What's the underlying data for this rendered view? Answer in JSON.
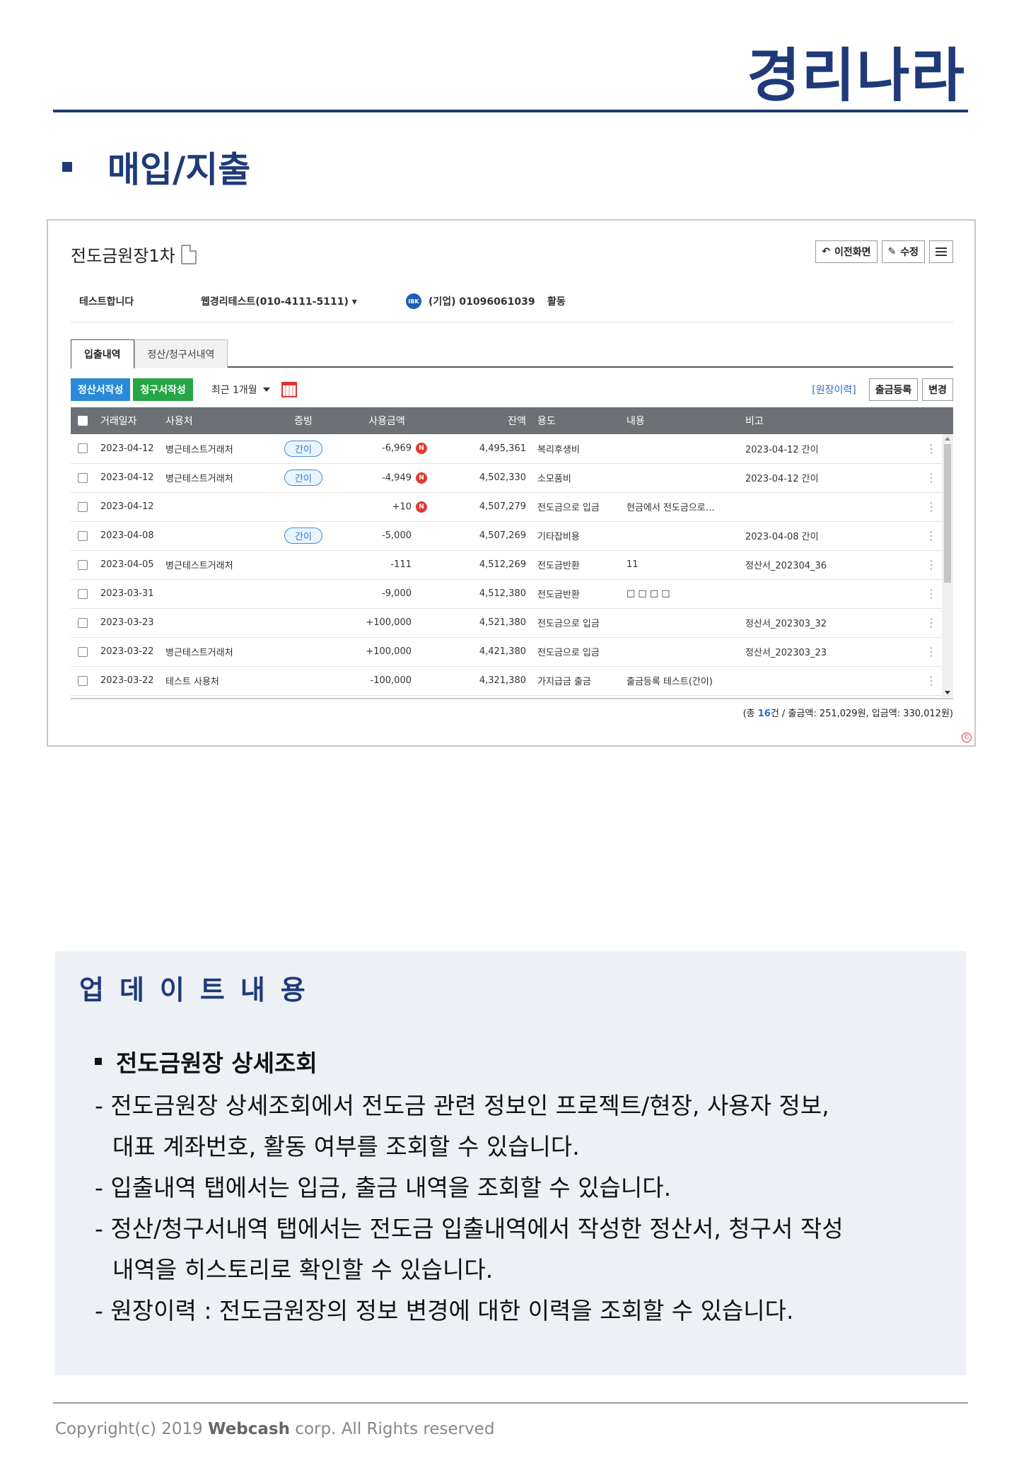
{
  "header": {
    "logo_text": "경리나라",
    "section_title": "매입/지출"
  },
  "screen": {
    "doc_title": "전도금원장1차",
    "buttons": {
      "back": "이전화면",
      "edit": "수정"
    },
    "info": {
      "project": "테스트합니다",
      "user": "웹경리테스트(010-4111-5111)",
      "account": "(기업) 01096061039",
      "status": "활동"
    },
    "tabs": [
      "입출내역",
      "정산/청구서내역"
    ],
    "toolbar": {
      "settlement_btn": "정산서작성",
      "invoice_btn": "청구서작성",
      "period": "최근 1개월",
      "history_link": "[원장이력]",
      "withdraw_btn": "출금등록",
      "change_btn": "변경"
    },
    "columns": [
      "거래일자",
      "사용처",
      "증빙",
      "사용금액",
      "잔액",
      "용도",
      "내용",
      "비고"
    ],
    "rows": [
      {
        "date": "2023-04-12",
        "place": "병근테스트거래처",
        "proof": "간이",
        "amount": "-6,969",
        "n": "N",
        "balance": "4,495,361",
        "use": "복리후생비",
        "content": "",
        "note": "2023-04-12 간이"
      },
      {
        "date": "2023-04-12",
        "place": "병근테스트거래처",
        "proof": "간이",
        "amount": "-4,949",
        "n": "N",
        "balance": "4,502,330",
        "use": "소모품비",
        "content": "",
        "note": "2023-04-12 간이"
      },
      {
        "date": "2023-04-12",
        "place": "",
        "proof": "",
        "amount": "+10",
        "n": "N",
        "balance": "4,507,279",
        "use": "전도금으로 입금",
        "content": "현금에서 전도금으로…",
        "note": ""
      },
      {
        "date": "2023-04-08",
        "place": "",
        "proof": "간이",
        "amount": "-5,000",
        "n": "",
        "balance": "4,507,269",
        "use": "기타잡비용",
        "content": "",
        "note": "2023-04-08 간이"
      },
      {
        "date": "2023-04-05",
        "place": "병근테스트거래처",
        "proof": "",
        "amount": "-111",
        "n": "",
        "balance": "4,512,269",
        "use": "전도금반환",
        "content": "11",
        "note": "정산서_202304_36"
      },
      {
        "date": "2023-03-31",
        "place": "",
        "proof": "",
        "amount": "-9,000",
        "n": "",
        "balance": "4,512,380",
        "use": "전도금반환",
        "content": "□ □ □ □",
        "note": ""
      },
      {
        "date": "2023-03-23",
        "place": "",
        "proof": "",
        "amount": "+100,000",
        "n": "",
        "balance": "4,521,380",
        "use": "전도금으로 입금",
        "content": "",
        "note": "정산서_202303_32"
      },
      {
        "date": "2023-03-22",
        "place": "병근테스트거래처",
        "proof": "",
        "amount": "+100,000",
        "n": "",
        "balance": "4,421,380",
        "use": "전도금으로 입금",
        "content": "",
        "note": "정산서_202303_23"
      },
      {
        "date": "2023-03-22",
        "place": "테스트 사용처",
        "proof": "",
        "amount": "-100,000",
        "n": "",
        "balance": "4,321,380",
        "use": "가지급금 출금",
        "content": "출금등록 테스트(간이)",
        "note": ""
      }
    ],
    "summary": {
      "prefix": "(총 ",
      "count": "16",
      "suffix": "건 / 출금액: 251,029원, 입금액: 330,012원)"
    }
  },
  "update": {
    "heading": "업데이트내용",
    "subheading": "전도금원장 상세조회",
    "lines": [
      "- 전도금원장 상세조회에서 전도금 관련 정보인 프로젝트/현장, 사용자 정보,",
      "대표 계좌번호, 활동 여부를 조회할 수 있습니다.",
      "- 입출내역 탭에서는 입금, 출금 내역을 조회할 수 있습니다.",
      "- 정산/청구서내역 탭에서는 전도금 입출내역에서 작성한 정산서, 청구서 작성",
      "내역을 히스토리로 확인할 수 있습니다.",
      "- 원장이력 : 전도금원장의 정보 변경에 대한 이력을 조회할 수 있습니다."
    ]
  },
  "footer": {
    "copyright_pre": "Copyright(c) 2019 ",
    "brand": "Webcash",
    "copyright_post": " corp. All Rights reserved"
  },
  "colors": {
    "brand": "#1e3a78",
    "blue_btn": "#2a8ad8",
    "green_btn": "#26a646",
    "badge_red": "#e53935"
  }
}
